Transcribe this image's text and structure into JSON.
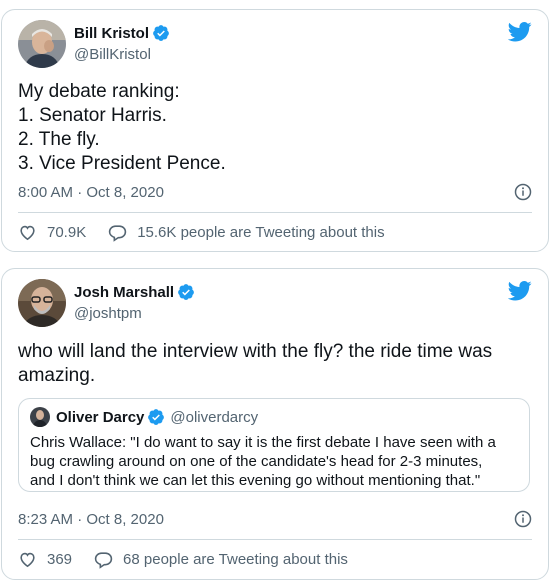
{
  "colors": {
    "accent": "#1d9bf0",
    "text": "#0f1419",
    "secondary": "#536471",
    "border": "#cfd9de"
  },
  "tweets": [
    {
      "author_name": "Bill Kristol",
      "author_handle": "@BillKristol",
      "verified_icon": "verified-badge-icon",
      "text_lines": [
        "My debate ranking:",
        "1. Senator Harris.",
        "2. The fly.",
        "3. Vice President Pence."
      ],
      "timestamp": "8:00 AM · Oct 8, 2020",
      "likes": "70.9K",
      "tweeting": "15.6K people are Tweeting about this"
    },
    {
      "author_name": "Josh Marshall",
      "author_handle": "@joshtpm",
      "verified_icon": "verified-badge-icon",
      "text_lines": [
        "who will land the interview with the fly? the ride time was",
        "amazing."
      ],
      "quoted": {
        "author_name": "Oliver Darcy",
        "author_handle": "@oliverdarcy",
        "text_lines": [
          "Chris Wallace: \"I do want to say it is the first debate I have seen with a",
          "bug crawling around on one of the candidate's head for 2-3 minutes,",
          "and I don't think we can let this evening go without mentioning that.\""
        ]
      },
      "timestamp": "8:23 AM · Oct 8, 2020",
      "likes": "369",
      "tweeting": "68 people are Tweeting about this"
    }
  ]
}
